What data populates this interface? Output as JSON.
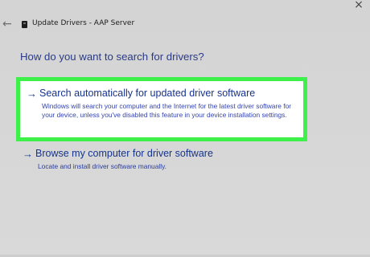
{
  "window": {
    "title": "Update Drivers - AAP Server",
    "close_glyph": "×",
    "back_glyph": "←"
  },
  "question": "How do you want to search for drivers?",
  "options": [
    {
      "arrow": "→",
      "heading": "Search automatically for updated driver software",
      "description": "Windows will search your computer and the Internet for the latest driver software for your device, unless you've disabled this feature in your device installation settings."
    },
    {
      "arrow": "→",
      "heading": "Browse my computer for driver software",
      "description": "Locate and install driver software manually."
    }
  ],
  "colors": {
    "highlight": "#3ef04a",
    "link": "#163d8f"
  }
}
